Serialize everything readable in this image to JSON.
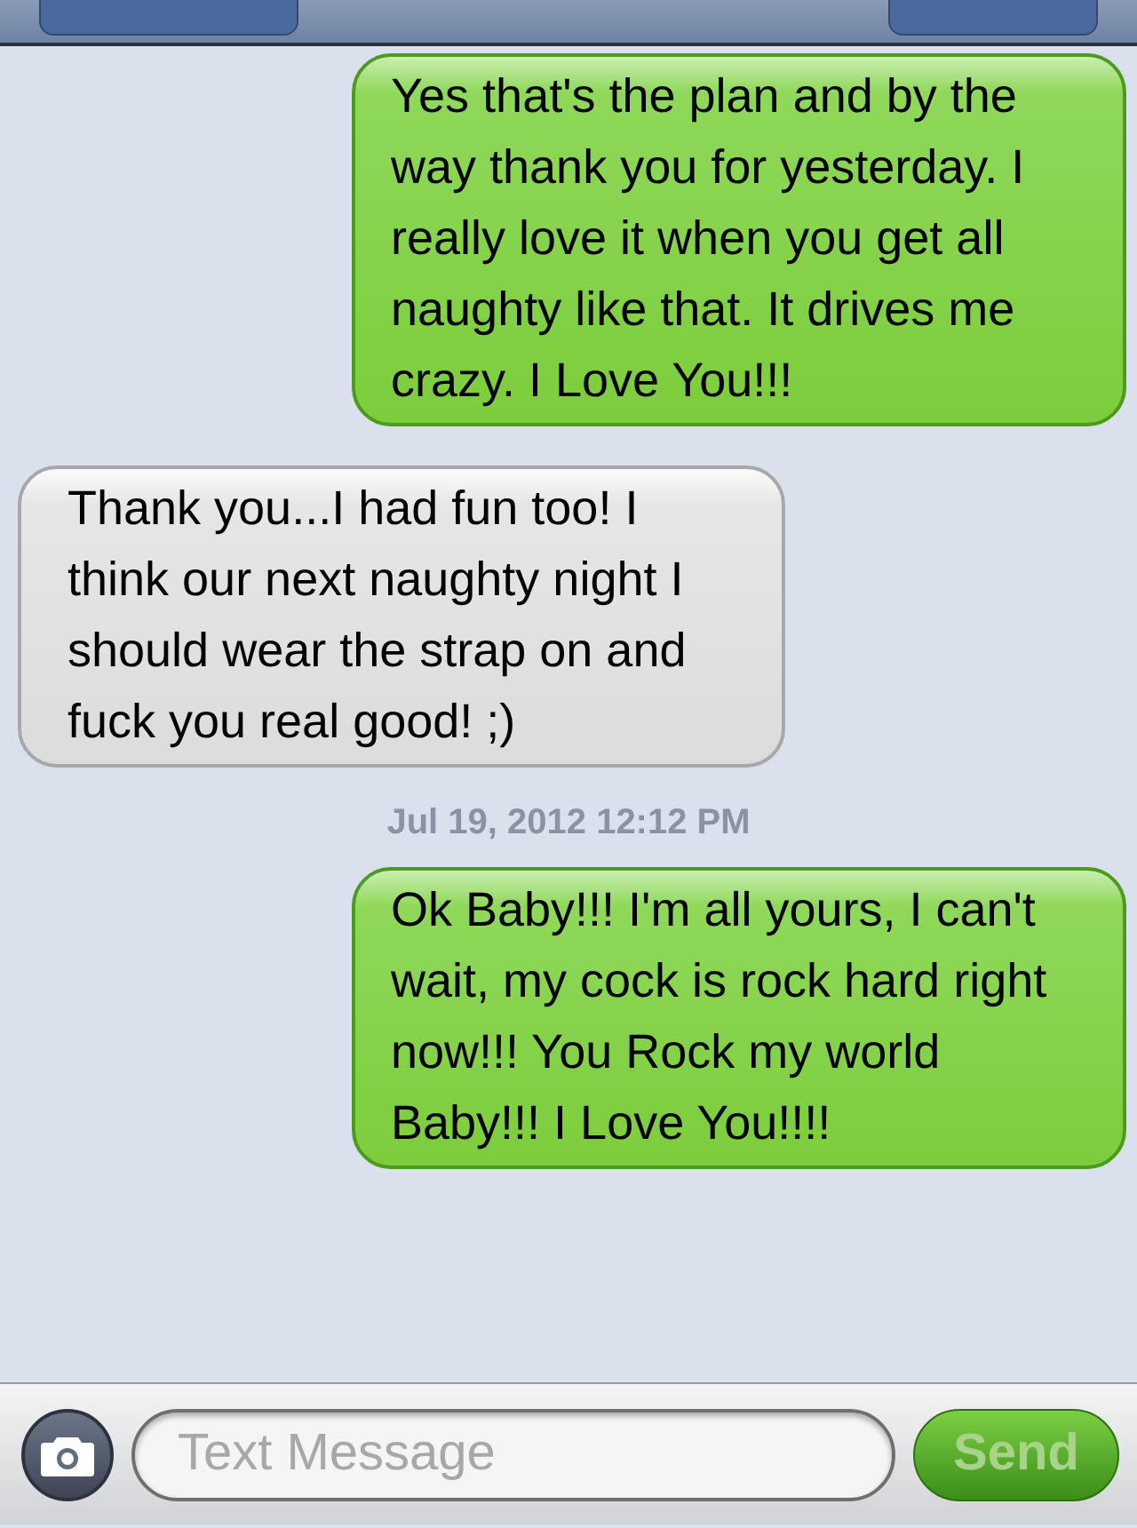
{
  "messages": [
    {
      "kind": "sent",
      "text": "Yes that's the plan and by the way thank you for yesterday. I really love it when you get all naughty like that. It drives me crazy. I Love You!!!"
    },
    {
      "kind": "received",
      "text": "Thank you...I had fun too! I think our next naughty night I should wear the strap on and fuck you real good! ;)"
    },
    {
      "kind": "timestamp",
      "text": "Jul 19, 2012 12:12 PM"
    },
    {
      "kind": "sent",
      "text": "Ok Baby!!! I'm all yours, I can't wait, my cock is rock hard right now!!! You Rock my world Baby!!! I Love You!!!!"
    }
  ],
  "compose": {
    "placeholder": "Text Message"
  },
  "send_button": {
    "label": "Send",
    "disabled": true
  }
}
